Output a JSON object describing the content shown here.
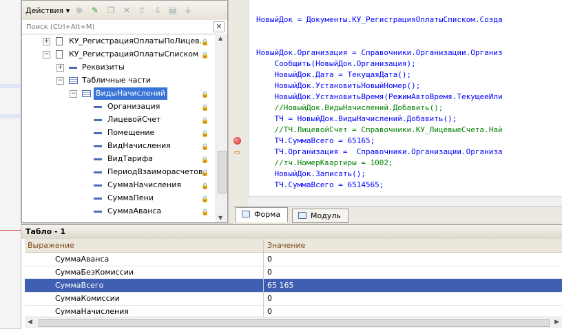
{
  "toolbar": {
    "actions_label": "Действия ▾"
  },
  "search": {
    "placeholder": "Поиск (Ctrl+Alt+M)"
  },
  "tree": {
    "items": [
      {
        "label": "КУ_РегистрацияОплатыПоЛицев...",
        "expander": "+"
      },
      {
        "label": "КУ_РегистрацияОплатыСписком",
        "expander": "−"
      },
      {
        "label": "Реквизиты",
        "expander": "+"
      },
      {
        "label": "Табличные части",
        "expander": "−"
      },
      {
        "label": "ВидыНачислений",
        "expander": "−"
      },
      {
        "label": "Организация"
      },
      {
        "label": "ЛицевойСчет"
      },
      {
        "label": "Помещение"
      },
      {
        "label": "ВидНачисления"
      },
      {
        "label": "ВидТарифа"
      },
      {
        "label": "ПериодВзаиморасчетов"
      },
      {
        "label": "СуммаНачисления"
      },
      {
        "label": "СуммаПени"
      },
      {
        "label": "СуммаАванса"
      }
    ]
  },
  "code": {
    "lines": [
      "НовыйДок = Документы.КУ_РегистрацияОплатыСписком.Созда",
      "",
      "",
      "НовыйДок.Организация = Справочники.Организации.Организ",
      "    Сообщить(НовыйДок.Организация);",
      "    НовыйДок.Дата = ТекущаяДата();",
      "    НовыйДок.УстановитьНовыйНомер();",
      "    НовыйДок.УстановитьВремя(РежимАвтоВремя.ТекущееИли",
      "    //НовыйДок.ВидыНачислений.Добавить();",
      "    ТЧ = НовыйДок.ВидыНачислений.Добавить();",
      "    //ТЧ.ЛицевойСчет = Справочники.КУ_ЛицевыеСчета.Най",
      "    ТЧ.СуммаВсего = 65165;",
      "    ТЧ.Организация =  Справочники.Организации.Организа",
      "    //тч.НомерКвартиры = 1002;",
      "    НовыйДок.Записать();",
      "    ТЧ.СуммаВсего = 6514565;"
    ],
    "comment_line_indexes": [
      8,
      10,
      13
    ]
  },
  "tabs": [
    {
      "label": "Форма",
      "active": true
    },
    {
      "label": "Модуль",
      "active": false
    }
  ],
  "tablo": {
    "title": "Табло - 1",
    "columns": [
      "Выражение",
      "Значение"
    ],
    "rows": [
      {
        "expr": "СуммаАванса",
        "value": "0"
      },
      {
        "expr": "СуммаБезКомиссии",
        "value": "0"
      },
      {
        "expr": "СуммаВсего",
        "value": "65 165"
      },
      {
        "expr": "СуммаКомиссии",
        "value": "0"
      },
      {
        "expr": "СуммаНачисления",
        "value": "0"
      }
    ],
    "selected_row": 2
  },
  "colors": {
    "selection": "#3e5fb2",
    "code_text": "#0000ff",
    "comment": "#008000"
  }
}
